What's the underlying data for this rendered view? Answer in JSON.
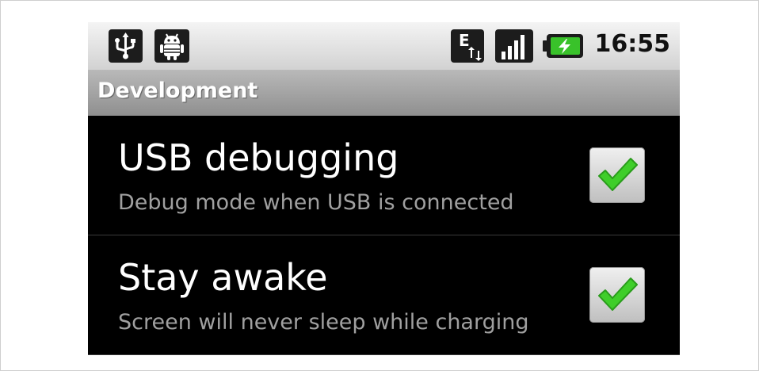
{
  "status_bar": {
    "time": "16:55",
    "network_type": "E",
    "icons": [
      "usb-icon",
      "android-debug-icon",
      "network-edge-icon",
      "signal-icon",
      "battery-charging-icon"
    ],
    "battery_accent": "#39c22a"
  },
  "header": {
    "title": "Development"
  },
  "preferences": [
    {
      "title": "USB debugging",
      "summary": "Debug mode when USB is connected",
      "checked": true
    },
    {
      "title": "Stay awake",
      "summary": "Screen will never sleep while charging",
      "checked": true
    }
  ],
  "colors": {
    "check_green": "#3fce2a",
    "background": "#000000",
    "title_bar": "#a4a4a4"
  }
}
